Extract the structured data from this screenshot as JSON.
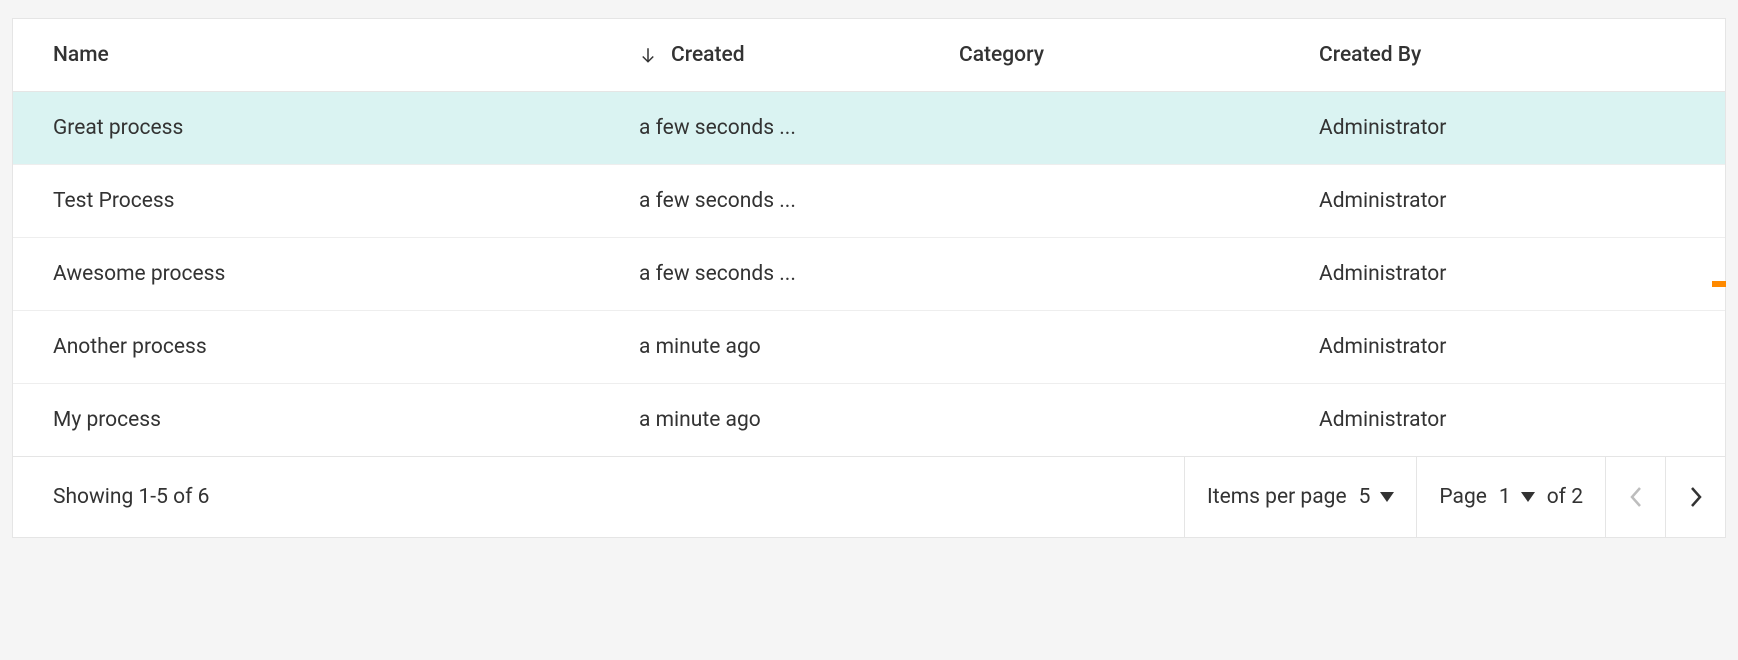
{
  "table": {
    "headers": {
      "name": "Name",
      "created": "Created",
      "category": "Category",
      "createdBy": "Created By"
    },
    "rows": [
      {
        "name": "Great process",
        "created": "a few seconds ...",
        "category": "",
        "createdBy": "Administrator",
        "selected": true
      },
      {
        "name": "Test Process",
        "created": "a few seconds ...",
        "category": "",
        "createdBy": "Administrator",
        "selected": false
      },
      {
        "name": "Awesome process",
        "created": "a few seconds ...",
        "category": "",
        "createdBy": "Administrator",
        "selected": false
      },
      {
        "name": "Another process",
        "created": "a minute ago",
        "category": "",
        "createdBy": "Administrator",
        "selected": false
      },
      {
        "name": "My process",
        "created": "a minute ago",
        "category": "",
        "createdBy": "Administrator",
        "selected": false
      }
    ]
  },
  "pagination": {
    "showing": "Showing 1-5 of 6",
    "itemsPerPageLabel": "Items per page",
    "itemsPerPageValue": "5",
    "pageLabelPrefix": "Page",
    "pageCurrent": "1",
    "pageOf": "of 2"
  }
}
